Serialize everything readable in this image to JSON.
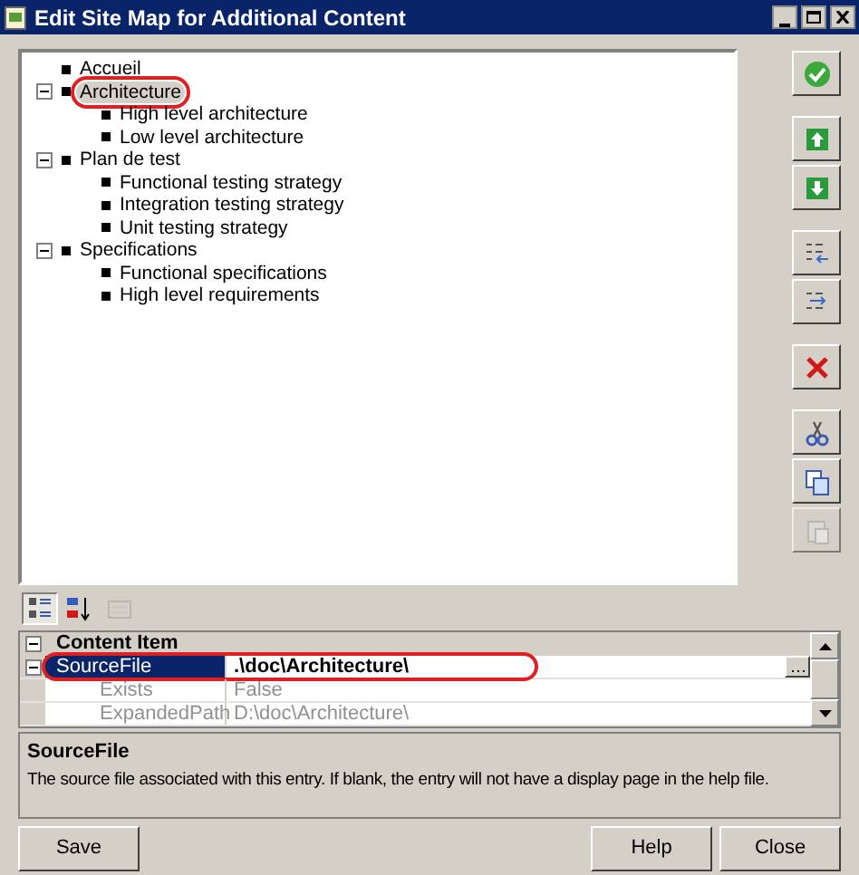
{
  "window": {
    "title": "Edit Site Map for Additional Content"
  },
  "tree": [
    {
      "label": "Accueil",
      "selected": false,
      "circled": false
    },
    {
      "label": "Architecture",
      "selected": true,
      "circled": true,
      "expanded": true,
      "children": [
        {
          "label": "High level architecture",
          "selected": false,
          "circled": false
        },
        {
          "label": "Low level architecture",
          "selected": false,
          "circled": false
        }
      ]
    },
    {
      "label": "Plan de test",
      "selected": false,
      "circled": false,
      "expanded": true,
      "children": [
        {
          "label": "Functional testing strategy",
          "selected": false,
          "circled": false
        },
        {
          "label": "Integration testing strategy",
          "selected": false,
          "circled": false
        },
        {
          "label": "Unit testing strategy",
          "selected": false,
          "circled": false
        }
      ]
    },
    {
      "label": "Specifications",
      "selected": false,
      "circled": false,
      "expanded": true,
      "children": [
        {
          "label": "Functional specifications",
          "selected": false,
          "circled": false
        },
        {
          "label": "High level requirements",
          "selected": false,
          "circled": false
        }
      ]
    }
  ],
  "side_groups": [
    [
      {
        "kind": "ok",
        "disabled": false
      }
    ],
    [
      {
        "kind": "up",
        "disabled": false
      },
      {
        "kind": "down",
        "disabled": false
      }
    ],
    [
      {
        "kind": "outdent",
        "disabled": false
      },
      {
        "kind": "indent",
        "disabled": false
      }
    ],
    [
      {
        "kind": "delete",
        "disabled": false
      }
    ],
    [
      {
        "kind": "cut",
        "disabled": false
      },
      {
        "kind": "copy",
        "disabled": false
      },
      {
        "kind": "paste",
        "disabled": true
      }
    ]
  ],
  "grid_toolbar": [
    {
      "kind": "categorized",
      "selected": true,
      "disabled": false
    },
    {
      "kind": "alphabetical",
      "selected": false,
      "disabled": false
    },
    {
      "kind": "pages",
      "selected": false,
      "disabled": true
    }
  ],
  "properties": {
    "category": "Content Item",
    "expanded": true,
    "rows": [
      {
        "name": "SourceFile",
        "value": ".\\doc\\Architecture\\",
        "selected": true,
        "circled": true,
        "readonly": false,
        "has_browse": true,
        "expanded": true,
        "children": [
          {
            "name": "Exists",
            "value": "False",
            "selected": false,
            "readonly": true
          },
          {
            "name": "ExpandedPath",
            "value": "D:\\doc\\Architecture\\",
            "selected": false,
            "readonly": true
          }
        ]
      }
    ]
  },
  "description": {
    "title": "SourceFile",
    "text": "The source file associated with this entry.  If blank, the entry will not have a display page in the help file."
  },
  "buttons": [
    {
      "label": "Save"
    },
    {
      "label": "Help"
    },
    {
      "label": "Close"
    }
  ]
}
